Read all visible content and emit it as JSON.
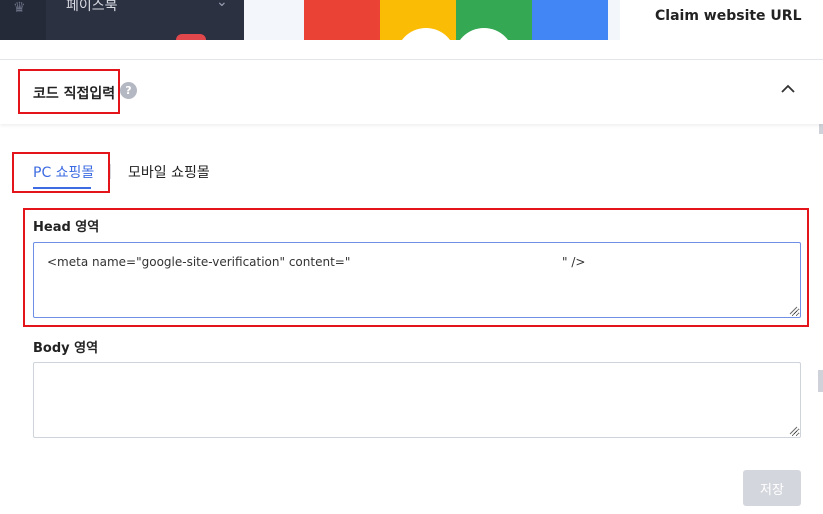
{
  "background": {
    "nav": {
      "facebook_label": "페이스북",
      "nav_glyph": "♛",
      "chevron": "⌄"
    },
    "google_colors": [
      "#ea4335",
      "#fbbc05",
      "#34a853",
      "#4285f4"
    ],
    "claim_label": "Claim website URL"
  },
  "section": {
    "title": "코드 직접입력",
    "help": "?",
    "collapse_icon": "chevron-up-icon"
  },
  "tabs": {
    "pc": "PC 쇼핑몰",
    "mobile": "모바일 쇼핑몰",
    "active": "pc"
  },
  "head": {
    "label": "Head 영역",
    "value_start": "<meta name=\"google-site-verification\" content=\"",
    "value_end": "\" />"
  },
  "body_area": {
    "label": "Body 영역",
    "value": ""
  },
  "save_label": "저장",
  "colors": {
    "accent": "#3d6be2",
    "highlight_red": "#e4141b",
    "disabled_button": "#d3d6dc"
  }
}
